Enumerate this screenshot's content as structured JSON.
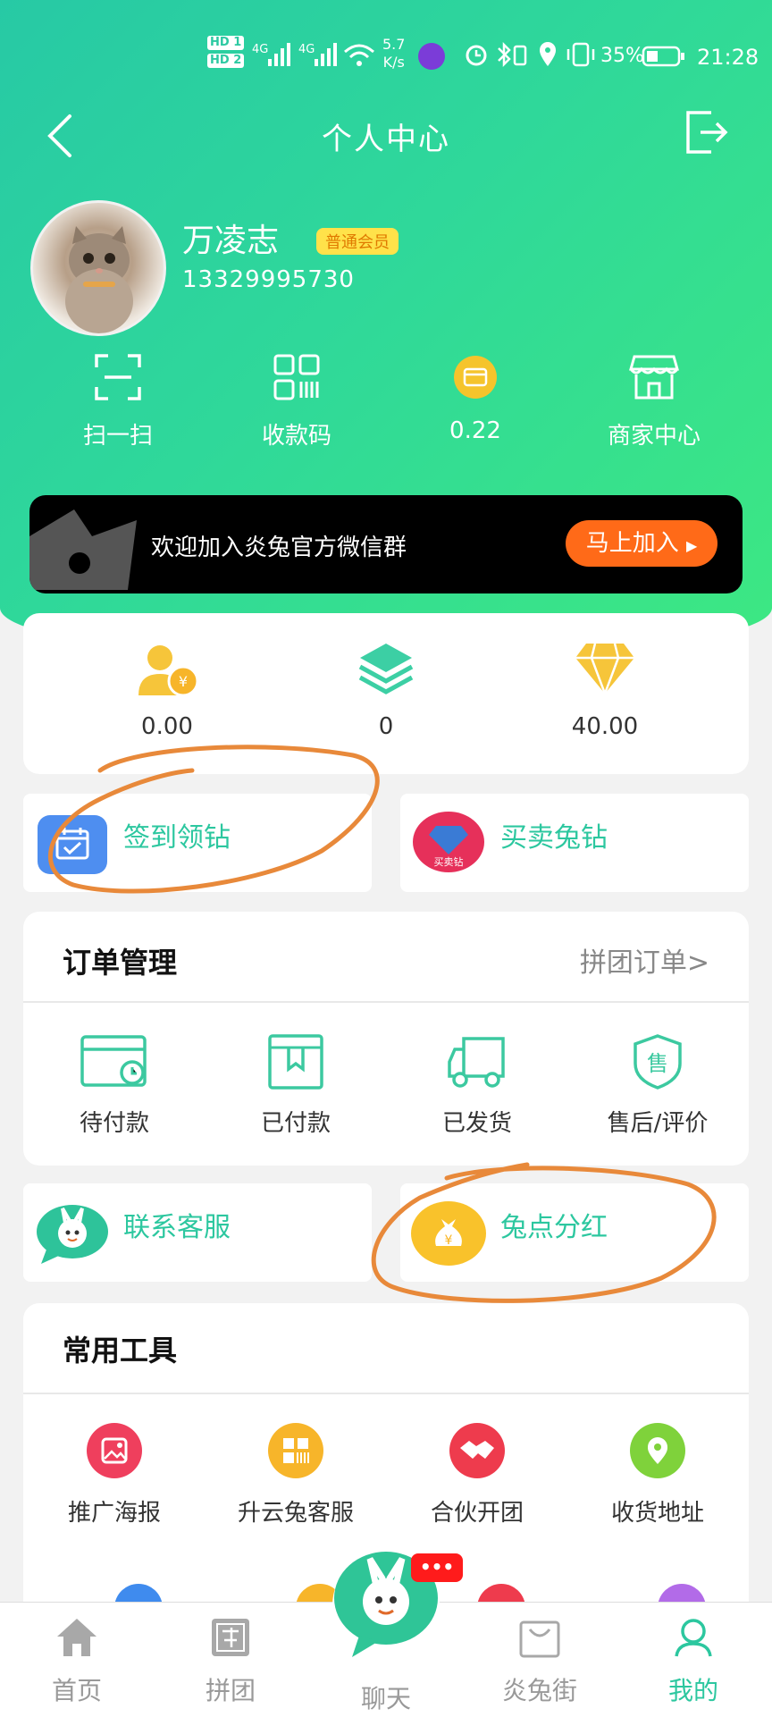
{
  "status_bar": {
    "sim1": "HD 1",
    "sim2": "HD 2",
    "net1": "4G",
    "net2": "4G",
    "speed": "5.7",
    "speed_unit": "K/s",
    "battery": "35%",
    "time": "21:28"
  },
  "header": {
    "title": "个人中心"
  },
  "profile": {
    "name": "万凌志",
    "badge": "普通会员",
    "phone": "13329995730"
  },
  "quick_actions": [
    {
      "label": "扫一扫",
      "icon": "scan-icon"
    },
    {
      "label": "收款码",
      "icon": "qr-code-icon"
    },
    {
      "label": "0.22",
      "icon": "coin-card-icon"
    },
    {
      "label": "商家中心",
      "icon": "store-icon"
    }
  ],
  "banner": {
    "text": "欢迎加入炎兔官方微信群",
    "button": "马上加入"
  },
  "stats": [
    {
      "value": "0.00",
      "icon": "user-yuan-icon"
    },
    {
      "value": "0",
      "icon": "layers-icon"
    },
    {
      "value": "40.00",
      "icon": "diamond-icon"
    }
  ],
  "promo_cards": {
    "checkin": {
      "label": "签到领钻",
      "icon": "calendar-check-icon"
    },
    "trade": {
      "label": "买卖兔钻",
      "icon_text": "买卖钻"
    }
  },
  "orders": {
    "title": "订单管理",
    "link": "拼团订单>",
    "items": [
      {
        "label": "待付款",
        "icon": "wallet-clock-icon"
      },
      {
        "label": "已付款",
        "icon": "bookmark-box-icon"
      },
      {
        "label": "已发货",
        "icon": "truck-icon"
      },
      {
        "label": "售后/评价",
        "icon": "shield-sale-icon"
      }
    ],
    "shield_char": "售"
  },
  "service_cards": {
    "support": {
      "label": "联系客服",
      "icon": "rabbit-chat-icon"
    },
    "dividend": {
      "label": "兔点分红",
      "icon": "money-bag-icon"
    }
  },
  "tools": {
    "title": "常用工具",
    "items": [
      {
        "label": "推广海报",
        "icon": "poster-icon"
      },
      {
        "label": "升云兔客服",
        "icon": "grid-service-icon"
      },
      {
        "label": "合伙开团",
        "icon": "handshake-icon"
      },
      {
        "label": "收货地址",
        "icon": "location-icon"
      }
    ]
  },
  "tabbar": {
    "items": [
      {
        "label": "首页",
        "icon": "home-icon"
      },
      {
        "label": "拼团",
        "icon": "group-buy-icon"
      },
      {
        "label": "聊天",
        "icon": "chat-rabbit-icon"
      },
      {
        "label": "炎兔街",
        "icon": "shopping-bag-icon"
      },
      {
        "label": "我的",
        "icon": "profile-icon"
      }
    ],
    "chat_badge": "•••"
  },
  "colors": {
    "brand_green": "#2fd89a",
    "accent_teal": "#2cc79f",
    "join_orange": "#ff6a18",
    "annotation_orange": "#e8893a"
  }
}
